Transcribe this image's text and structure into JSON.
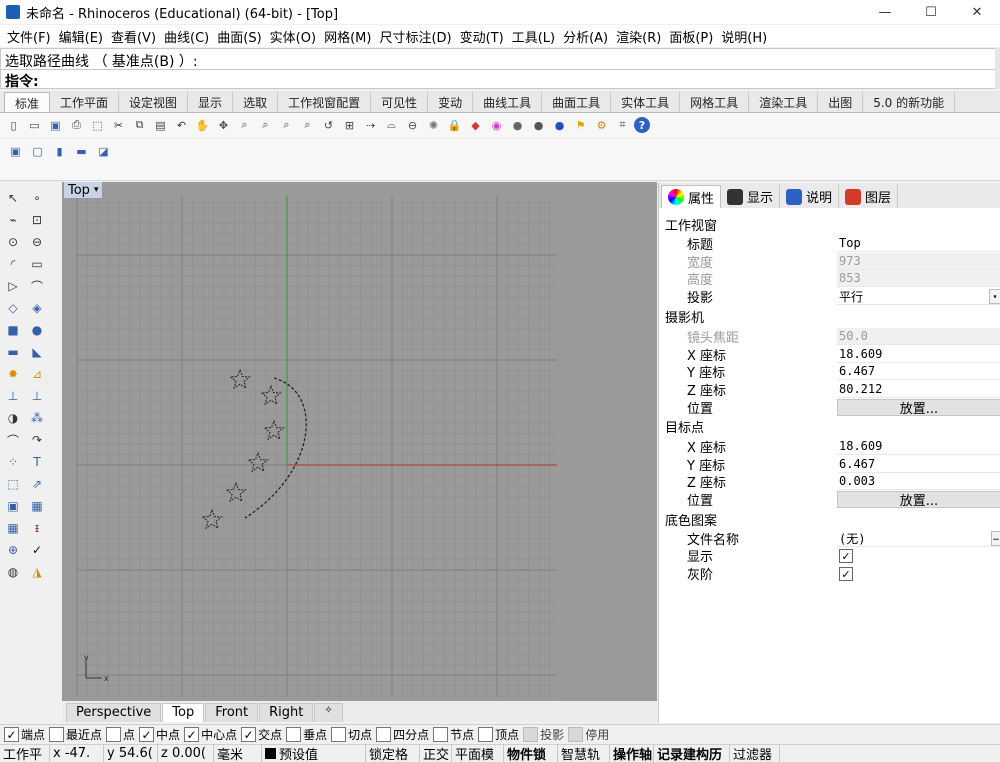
{
  "window": {
    "title": "未命名 - Rhinoceros (Educational) (64-bit) - [Top]",
    "minimize": "—",
    "maximize": "☐",
    "close": "✕"
  },
  "menu": [
    "文件(F)",
    "编辑(E)",
    "查看(V)",
    "曲线(C)",
    "曲面(S)",
    "实体(O)",
    "网格(M)",
    "尺寸标注(D)",
    "变动(T)",
    "工具(L)",
    "分析(A)",
    "渲染(R)",
    "面板(P)",
    "说明(H)"
  ],
  "command": {
    "history": "选取路径曲线 （ 基准点(B) ）:",
    "prompt": "指令:"
  },
  "toolbar_tabs": [
    "标准",
    "工作平面",
    "设定视图",
    "显示",
    "选取",
    "工作视窗配置",
    "可见性",
    "变动",
    "曲线工具",
    "曲面工具",
    "实体工具",
    "网格工具",
    "渲染工具",
    "出图",
    "5.0 的新功能"
  ],
  "toolbar_icons": [
    "new-file-icon",
    "open-file-icon",
    "save-icon",
    "print-icon",
    "import-icon",
    "cut-icon",
    "copy-icon",
    "paste-icon",
    "undo-icon",
    "pan-icon",
    "rotate-view-icon",
    "zoom-icon",
    "zoom-window-icon",
    "zoom-extents-icon",
    "zoom-selected-icon",
    "undo-view-icon",
    "viewport-layout-icon",
    "select-icon",
    "grid-snap-icon",
    "named-cplane-icon",
    "light-icon",
    "lock-icon",
    "material-icon",
    "color-wheel-icon",
    "render-sphere-icon",
    "shaded-sphere-icon",
    "blue-sphere-icon",
    "options-icon",
    "gear-icon",
    "history-icon",
    "help-icon"
  ],
  "toolbar2_icons": [
    "box-view-icon",
    "viewport-icon",
    "properties-icon",
    "layout-icon",
    "display-mode-icon"
  ],
  "left_tools": [
    "select-arrow-icon",
    "point-icon",
    "polyline-icon",
    "curve-icon",
    "circle-icon",
    "ellipse-icon",
    "arc-icon",
    "rectangle-icon",
    "polygon-icon",
    "fillet-curve-icon",
    "surface-icon",
    "loft-icon",
    "box-icon",
    "sphere-icon",
    "cylinder-icon",
    "extrude-icon",
    "explode-icon",
    "trim-icon",
    "join-icon",
    "split-icon",
    "boolean-icon",
    "group-icon",
    "offset-icon",
    "blend-icon",
    "array-icon",
    "text-icon",
    "transform-icon",
    "scale-icon",
    "solid-icon",
    "hatch-icon",
    "mesh-icon",
    "dimension-icon",
    "analyze-icon",
    "check-icon",
    "render-icon",
    "paint-icon"
  ],
  "viewport": {
    "title": "Top",
    "tabs": [
      "Perspective",
      "Top",
      "Front",
      "Right"
    ],
    "active_tab": "Top",
    "add_tab": "✧",
    "axis_x": "x",
    "axis_y": "y"
  },
  "panel": {
    "tabs": [
      "属性",
      "显示",
      "说明",
      "图层"
    ],
    "sections": {
      "viewport": {
        "header": "工作视窗",
        "title_label": "标题",
        "title_value": "Top",
        "width_label": "宽度",
        "width_value": "973",
        "height_label": "高度",
        "height_value": "853",
        "projection_label": "投影",
        "projection_value": "平行"
      },
      "camera": {
        "header": "摄影机",
        "focal_label": "镜头焦距",
        "focal_value": "50.0",
        "x_label": "X 座标",
        "x_value": "18.609",
        "y_label": "Y 座标",
        "y_value": "6.467",
        "z_label": "Z 座标",
        "z_value": "80.212",
        "pos_label": "位置",
        "pos_button": "放置..."
      },
      "target": {
        "header": "目标点",
        "x_label": "X 座标",
        "x_value": "18.609",
        "y_label": "Y 座标",
        "y_value": "6.467",
        "z_label": "Z 座标",
        "z_value": "0.003",
        "pos_label": "位置",
        "pos_button": "放置..."
      },
      "wallpaper": {
        "header": "底色图案",
        "file_label": "文件名称",
        "file_value": "(无)",
        "show_label": "显示",
        "gray_label": "灰阶"
      }
    }
  },
  "osnap": [
    {
      "label": "端点",
      "checked": true
    },
    {
      "label": "最近点",
      "checked": false
    },
    {
      "label": "点",
      "checked": false
    },
    {
      "label": "中点",
      "checked": true
    },
    {
      "label": "中心点",
      "checked": true
    },
    {
      "label": "交点",
      "checked": true
    },
    {
      "label": "垂点",
      "checked": false
    },
    {
      "label": "切点",
      "checked": false
    },
    {
      "label": "四分点",
      "checked": false
    },
    {
      "label": "节点",
      "checked": false
    },
    {
      "label": "顶点",
      "checked": false
    },
    {
      "label": "投影",
      "checked": false,
      "disabled": true
    },
    {
      "label": "停用",
      "checked": false,
      "disabled": true
    }
  ],
  "status": {
    "cplane": "工作平",
    "x": "x -47.",
    "y": "y 54.6(",
    "z": "z 0.00(",
    "units": "毫米",
    "layer": "预设值",
    "grid_snap": "锁定格",
    "ortho": "正交",
    "planar": "平面模",
    "osnap": "物件锁",
    "smarttrack": "智慧轨",
    "gumball": "操作轴",
    "history": "记录建构历",
    "filter": "过滤器"
  },
  "colors": {
    "viewport_bg": "#9a9a9a",
    "grid_minor": "#8c8c8c",
    "grid_major": "#7e7e7e",
    "axis_x": "#b53030",
    "axis_y": "#2f9a2f"
  }
}
